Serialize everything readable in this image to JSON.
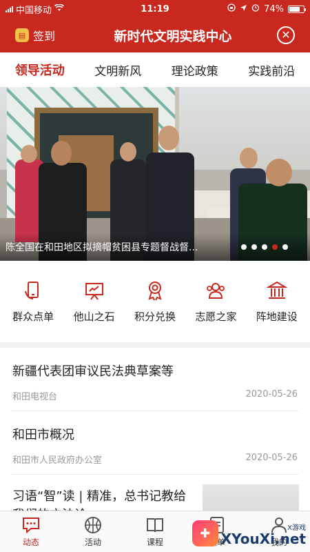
{
  "status_bar": {
    "carrier": "中国移动",
    "time": "11:19",
    "battery": "74%",
    "battery_level": 0.74
  },
  "header": {
    "checkin_label": "签到",
    "title": "新时代文明实践中心"
  },
  "tabs": [
    {
      "label": "领导活动",
      "active": true
    },
    {
      "label": "文明新风",
      "active": false
    },
    {
      "label": "理论政策",
      "active": false
    },
    {
      "label": "实践前沿",
      "active": false
    }
  ],
  "banner": {
    "caption": "陈全国在和田地区拟摘帽贫困县专题督战督...",
    "dot_count": 5,
    "active_dot": 4
  },
  "features": [
    {
      "label": "群众点单",
      "icon": "phone-hand-icon"
    },
    {
      "label": "他山之石",
      "icon": "presentation-board-icon"
    },
    {
      "label": "积分兑换",
      "icon": "award-ribbon-icon"
    },
    {
      "label": "志愿之家",
      "icon": "people-group-icon"
    },
    {
      "label": "阵地建设",
      "icon": "building-pillar-icon"
    }
  ],
  "news": [
    {
      "title": "新疆代表团审议民法典草案等",
      "source": "和田电视台",
      "date": "2020-05-26"
    },
    {
      "title": "和田市概况",
      "source": "和田市人民政府办公室",
      "date": "2020-05-26"
    },
    {
      "title": "习语“智”读 | 精准，总书记教给我们的方法论"
    }
  ],
  "bottom_nav": [
    {
      "label": "动态",
      "icon": "chat-bubble-icon",
      "active": true
    },
    {
      "label": "活动",
      "icon": "basketball-icon",
      "active": false
    },
    {
      "label": "课程",
      "icon": "book-icon",
      "active": false
    },
    {
      "label": "点单",
      "icon": "list-icon",
      "active": false
    },
    {
      "label": "我的",
      "icon": "user-icon",
      "active": false
    }
  ],
  "watermark": {
    "brand": "XYouXi.net",
    "small": "X游戏"
  },
  "colors": {
    "primary": "#c8281e",
    "text": "#222222",
    "muted": "#999999"
  }
}
